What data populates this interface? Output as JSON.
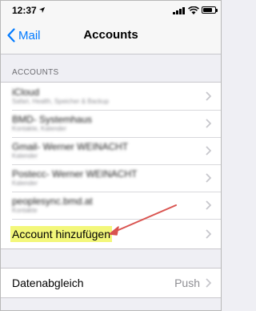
{
  "status_bar": {
    "time": "12:37",
    "location_arrow": "location-arrow-icon",
    "signal": "signal-icon",
    "wifi": "wifi-icon",
    "battery_level": 0.75
  },
  "nav": {
    "back_label": "Mail",
    "title": "Accounts"
  },
  "accounts_section": {
    "header": "ACCOUNTS",
    "items": [
      {
        "name": "iCloud",
        "subtitle": "Safari, Health, Speicher & Backup"
      },
      {
        "name": "BMD- Systemhaus",
        "subtitle": "Kontakte, Kalender"
      },
      {
        "name": "Gmail- Werner WEINACHT",
        "subtitle": "Kalender"
      },
      {
        "name": "Postecc- Werner WEINACHT",
        "subtitle": "Kalender"
      },
      {
        "name": "peoplesync.bmd.at",
        "subtitle": "Kontakte"
      }
    ],
    "add_account_label": "Account hinzufügen"
  },
  "fetch_section": {
    "label": "Datenabgleich",
    "value": "Push"
  },
  "colors": {
    "accent": "#007aff",
    "highlight": "#f3f77a",
    "annotation_arrow": "#d9534f"
  }
}
